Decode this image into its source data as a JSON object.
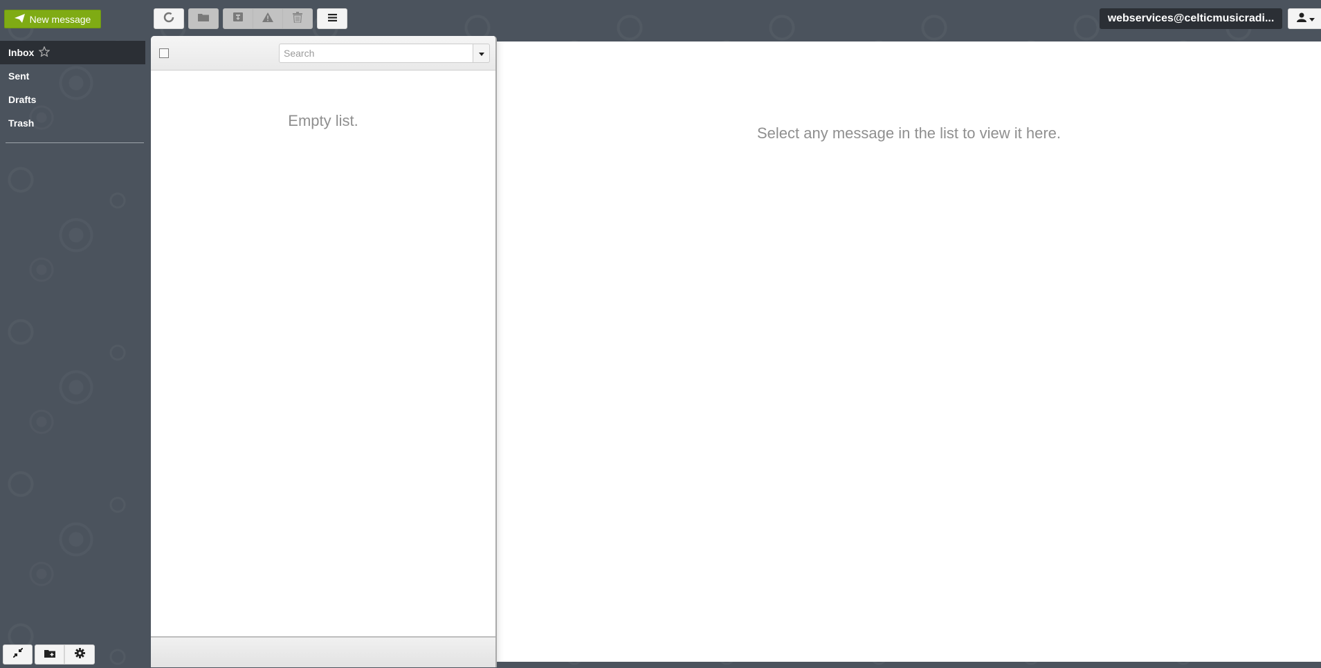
{
  "toolbar": {
    "new_message_label": "New message",
    "buttons": [
      {
        "name": "refresh",
        "icon": "refresh-icon",
        "enabled": true
      },
      {
        "name": "move-to-folder",
        "icon": "folder-icon",
        "enabled": false
      },
      {
        "name": "archive",
        "icon": "archive-icon",
        "enabled": false
      },
      {
        "name": "spam",
        "icon": "warning-icon",
        "enabled": false
      },
      {
        "name": "delete",
        "icon": "trash-icon",
        "enabled": false
      },
      {
        "name": "more",
        "icon": "menu-icon",
        "enabled": true
      }
    ]
  },
  "account": {
    "email": "webservices@celticmusicradi...",
    "user_menu_icon": "user-icon"
  },
  "sidebar": {
    "folders": [
      {
        "label": "Inbox",
        "active": true,
        "starred_icon": "star-outline-icon"
      },
      {
        "label": "Sent",
        "active": false
      },
      {
        "label": "Drafts",
        "active": false
      },
      {
        "label": "Trash",
        "active": false
      }
    ],
    "bottom_buttons": [
      {
        "name": "collapse",
        "icon": "collapse-arrows-icon"
      },
      {
        "name": "add-folder",
        "icon": "folder-plus-icon"
      },
      {
        "name": "settings",
        "icon": "gear-icon"
      }
    ]
  },
  "message_list": {
    "search_placeholder": "Search",
    "search_value": "",
    "empty_text": "Empty list."
  },
  "preview": {
    "placeholder_text": "Select any message in the list to view it here."
  },
  "colors": {
    "accent_green": "#7fab14",
    "background": "#4b535d",
    "active_folder_bg": "#2b2f35"
  }
}
